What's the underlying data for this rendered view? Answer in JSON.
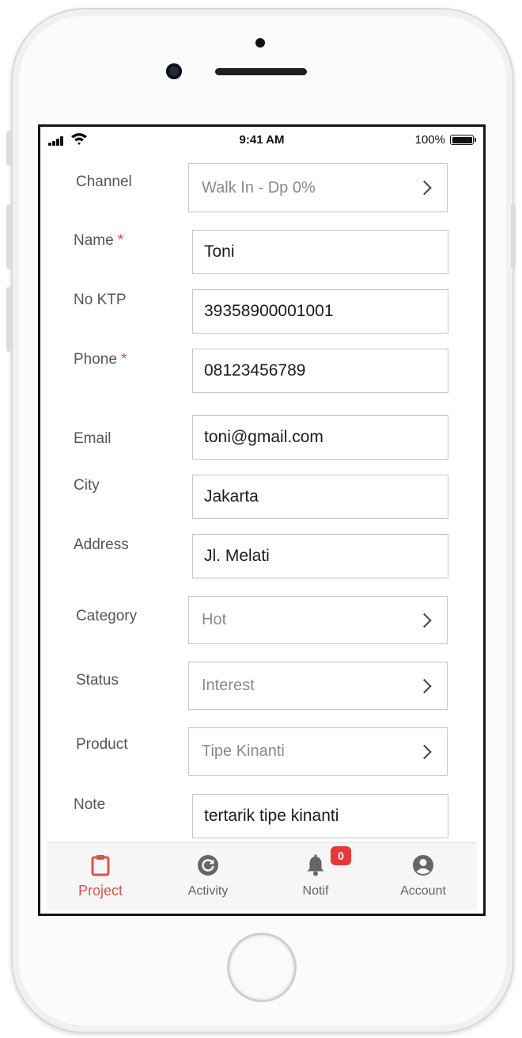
{
  "status_bar": {
    "time": "9:41 AM",
    "battery": "100%"
  },
  "form": {
    "channel": {
      "label": "Channel",
      "value": "Walk In - Dp 0%"
    },
    "name": {
      "label": "Name",
      "required_mark": "*",
      "value": "Toni"
    },
    "no_ktp": {
      "label": "No KTP",
      "value": "39358900001001"
    },
    "phone": {
      "label": "Phone",
      "required_mark": "*",
      "value": "08123456789"
    },
    "email": {
      "label": "Email",
      "value": "toni@gmail.com"
    },
    "city": {
      "label": "City",
      "value": "Jakarta"
    },
    "address": {
      "label": "Address",
      "value": "Jl. Melati"
    },
    "category": {
      "label": "Category",
      "value": "Hot"
    },
    "status": {
      "label": "Status",
      "value": "Interest"
    },
    "product": {
      "label": "Product",
      "value": "Tipe Kinanti"
    },
    "note": {
      "label": "Note",
      "value": "tertarik tipe kinanti"
    }
  },
  "bottom_nav": {
    "items": [
      {
        "label": "Project",
        "icon": "clipboard-icon",
        "active": true
      },
      {
        "label": "Activity",
        "icon": "refresh-icon",
        "active": false
      },
      {
        "label": "Notif",
        "icon": "bell-icon",
        "active": false,
        "badge": "0"
      },
      {
        "label": "Account",
        "icon": "account-circle-icon",
        "active": false
      }
    ]
  },
  "colors": {
    "accent": "#d9534f",
    "badge": "#e53935",
    "border": "#c6c6c6"
  }
}
